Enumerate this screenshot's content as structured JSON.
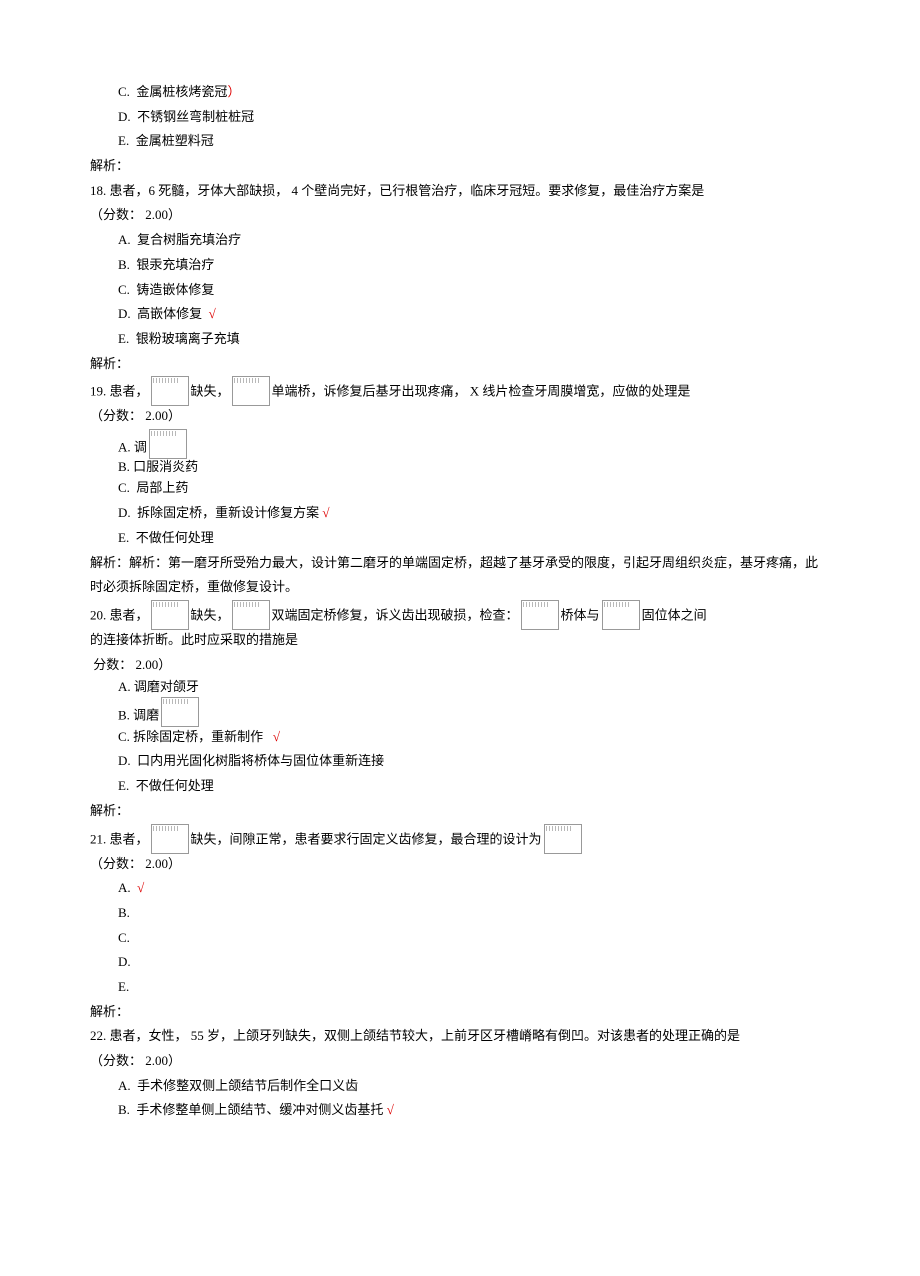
{
  "top_options": {
    "c": "金属桩核烤瓷冠",
    "c_mark": "）",
    "d": "不锈钢丝弯制桩桩冠",
    "e": "金属桩塑料冠"
  },
  "parse_label": "解析：",
  "q18": {
    "stem": "18.  患者，6 死髓，牙体大部缺损， 4 个壁尚完好，已行根管治疗，临床牙冠短。要求修复，最佳治疗方案是",
    "score": "（分数： 2.00）",
    "a": "复合树脂充填治疗",
    "b": "银汞充填治疗",
    "c": "铸造嵌体修复",
    "d": "高嵌体修复",
    "d_mark": "√",
    "e": "银粉玻璃离子充填"
  },
  "q19": {
    "pre": "19. 患者，",
    "mid1": "缺失，",
    "mid2": "单端桥，诉修复后基牙出现疼痛， X 线片检查牙周膜增宽，应做的处理是",
    "score": "（分数： 2.00）",
    "a": "A. 调",
    "b": "B. 口服消炎药",
    "c": "局部上药",
    "d": "拆除固定桥，重新设计修复方案",
    "d_mark": "√",
    "e": "不做任何处理",
    "parse": "解析：解析：第一磨牙所受殆力最大，设计第二磨牙的单端固定桥，超越了基牙承受的限度，引起牙周组织炎症，基牙疼痛，此时必须拆除固定桥，重做修复设计。"
  },
  "q20": {
    "pre": "20.  患者，",
    "mid1": "缺失，",
    "mid2": "双端固定桥修复，诉义齿出现破损，检查：",
    "mid3": "桥体与",
    "mid4": "固位体之间",
    "line2": "的连接体折断。此时应采取的措施是",
    "score": "分数： 2.00）",
    "a": "A. 调磨对颌牙",
    "b": "B. 调磨",
    "c": "C. 拆除固定桥，重新制作",
    "c_mark": "√",
    "d": "口内用光固化树脂将桥体与固位体重新连接",
    "e": "不做任何处理"
  },
  "q21": {
    "pre": "21. 患者，",
    "mid1": "缺失，间隙正常，患者要求行固定义齿修复，最合理的设计为",
    "score": "（分数： 2.00）",
    "a_mark": "√"
  },
  "q22": {
    "stem": "22.  患者，女性， 55 岁，上颌牙列缺失，双侧上颌结节较大，上前牙区牙槽嵴略有倒凹。对该患者的处理正确的是",
    "score": "（分数： 2.00）",
    "a": "手术修整双侧上颌结节后制作全口义齿",
    "b": "手术修整单侧上颌结节、缓冲对侧义齿基托",
    "b_mark": "√"
  }
}
